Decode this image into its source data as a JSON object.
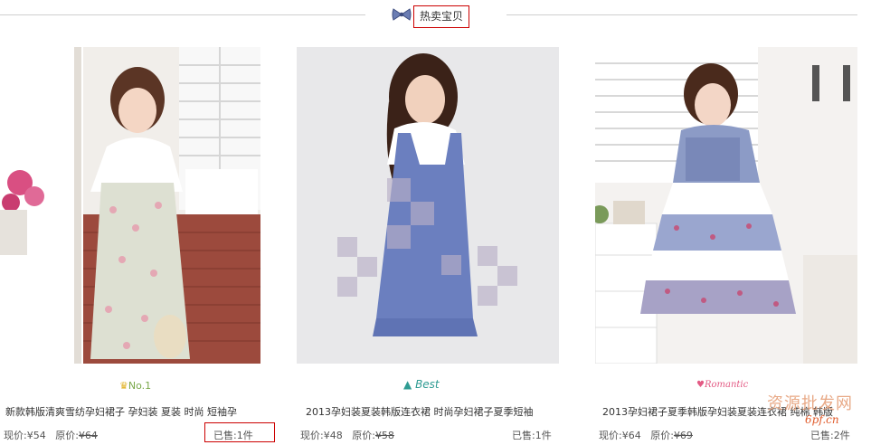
{
  "section": {
    "title": "热卖宝贝"
  },
  "products": [
    {
      "badge": "No.1",
      "name": "新款韩版清爽雪纺孕妇裙子 孕妇装 夏装 时尚 短袖孕",
      "price_label": "现价:",
      "price": "¥54",
      "orig_label": "原价:",
      "orig_price": "¥64",
      "sold": "已售:1件"
    },
    {
      "badge": "Best",
      "name": "2013孕妇装夏装韩版连衣裙 时尚孕妇裙子夏季短袖",
      "price_label": "现价:",
      "price": "¥48",
      "orig_label": "原价:",
      "orig_price": "¥58",
      "sold": "已售:1件"
    },
    {
      "badge": "Romantic",
      "name": "2013孕妇裙子夏季韩版孕妇装夏装连衣裙 纯棉 韩版",
      "price_label": "现价:",
      "price": "¥64",
      "orig_label": "原价:",
      "orig_price": "¥69",
      "sold": "已售:2件"
    }
  ],
  "watermark": {
    "line1": "资源批发网",
    "line2": "6pf.cn"
  },
  "colors": {
    "highlight_border": "#cc0000",
    "divider": "#cfcfcf",
    "badge_green": "#7aa84a",
    "badge_teal": "#2f9c93",
    "badge_pink": "#e35a84"
  },
  "icons": [
    "bow-icon",
    "crown-icon",
    "triangle-icon",
    "heart-icon"
  ]
}
